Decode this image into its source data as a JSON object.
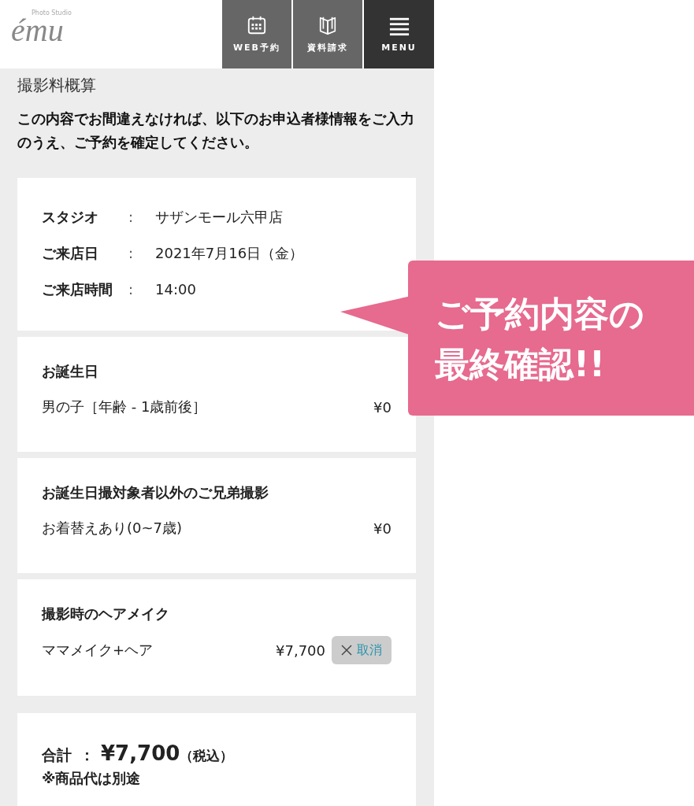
{
  "header": {
    "logo": {
      "brand": "ému",
      "tagline": "Photo Studio"
    },
    "nav": [
      {
        "label": "WEB予約",
        "kind": "calendar"
      },
      {
        "label": "資料請求",
        "kind": "book"
      },
      {
        "label": "MENU",
        "kind": "menu"
      }
    ]
  },
  "section_title": "撮影料概算",
  "instruction": "この内容でお間違えなければ、以下のお申込者様情報をご入力のうえ、ご予約を確定してください。",
  "reservation": [
    {
      "label": "スタジオ",
      "separator": ":",
      "value": "サザンモール六甲店"
    },
    {
      "label": "ご来店日",
      "separator": ":",
      "value": "2021年7月16日（金）"
    },
    {
      "label": "ご来店時間",
      "separator": ":",
      "value": "14:00"
    }
  ],
  "plans": [
    {
      "title": "お誕生日",
      "items": [
        {
          "name": "男の子［年齢 - 1歳前後］",
          "price": "¥0"
        }
      ]
    },
    {
      "title": "お誕生日撮対象者以外のご兄弟撮影",
      "items": [
        {
          "name": "お着替えあり(0~7歳)",
          "price": "¥0"
        }
      ]
    },
    {
      "title": "撮影時のヘアメイク",
      "items": [
        {
          "name": "ママメイク+ヘア",
          "price": "¥7,700",
          "cancel": "取消"
        }
      ]
    }
  ],
  "total": {
    "label": "合計",
    "separator": "：",
    "amount": "¥7,700",
    "tax": "（税込）",
    "note": "※商品代は別途"
  },
  "callout": {
    "lines": [
      "ご予約内容の",
      "最終確認!!"
    ]
  }
}
